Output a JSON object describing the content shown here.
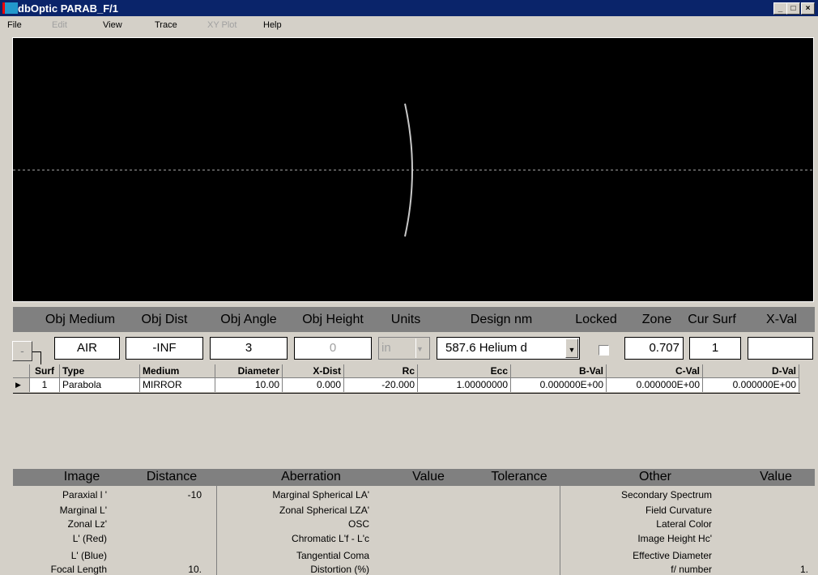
{
  "window": {
    "title": "dbOptic PARAB_F/1",
    "icon": "dboptic-app-icon"
  },
  "menu": [
    "File",
    "Edit",
    "View",
    "Trace",
    "XY Plot",
    "Help"
  ],
  "menu_disabled": [
    false,
    true,
    false,
    false,
    true,
    false
  ],
  "object_panel": {
    "headers": [
      "Obj Medium",
      "Obj Dist",
      "Obj Angle",
      "Obj Height",
      "Units",
      "Design nm",
      "Locked",
      "Zone",
      "Cur Surf",
      "X-Val"
    ],
    "collapse_button": "-",
    "obj_medium": "AIR",
    "obj_dist": "-INF",
    "obj_angle": "3",
    "obj_height": "0",
    "units": "in",
    "design_nm": "587.6 Helium d",
    "locked": false,
    "zone": "0.707",
    "cur_surf": "1",
    "x_val": ""
  },
  "surface_table": {
    "columns": [
      "Surf",
      "Type",
      "Medium",
      "Diameter",
      "X-Dist",
      "Rc",
      "Ecc",
      "B-Val",
      "C-Val",
      "D-Val"
    ],
    "rows": [
      [
        "1",
        "Parabola",
        "MIRROR",
        "10.00",
        "0.000",
        "-20.000",
        "1.00000000",
        "0.000000E+00",
        "0.000000E+00",
        "0.000000E+00"
      ]
    ]
  },
  "results": {
    "headers": [
      "Image",
      "Distance",
      "Aberration",
      "Value",
      "Tolerance",
      "Other",
      "Value"
    ],
    "image": [
      {
        "label": "Paraxial l '",
        "value": "-10"
      },
      {
        "label": "Marginal L'",
        "value": ""
      },
      {
        "label": "Zonal Lz'",
        "value": ""
      },
      {
        "label": "L' (Red)",
        "value": ""
      },
      {
        "label": "L' (Blue)",
        "value": ""
      },
      {
        "label": "Focal Length",
        "value": "10."
      }
    ],
    "aberration": [
      "Marginal Spherical  LA'",
      "Zonal Spherical  LZA'",
      "OSC",
      "Chromatic L'f - L'c",
      "Tangential Coma",
      "Distortion (%)"
    ],
    "other": [
      {
        "label": "Secondary Spectrum",
        "value": ""
      },
      {
        "label": "Field Curvature",
        "value": ""
      },
      {
        "label": "Lateral Color",
        "value": ""
      },
      {
        "label": "Image Height Hc'",
        "value": ""
      },
      {
        "label": "Effective Diameter",
        "value": ""
      },
      {
        "label": "f/ number",
        "value": "1."
      }
    ]
  }
}
